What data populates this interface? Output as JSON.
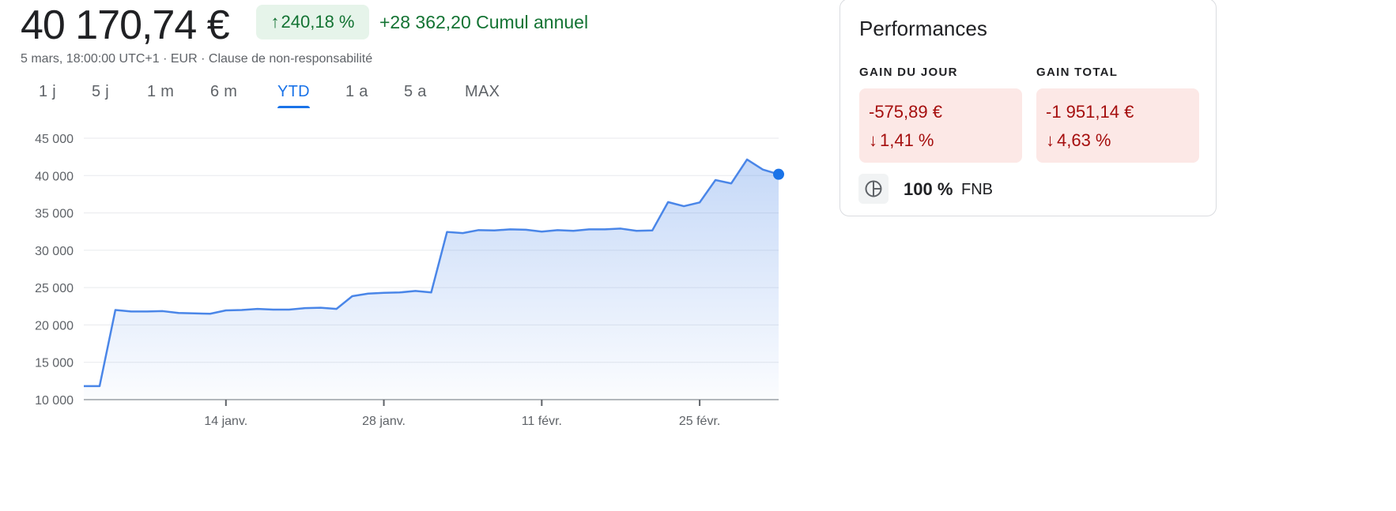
{
  "header": {
    "price": "40 170,74 €",
    "change_pct": "240,18 %",
    "change_abs": "+28 362,20",
    "change_period": "Cumul annuel",
    "timestamp": "5 mars, 18:00:00 UTC+1",
    "currency": "EUR",
    "disclaimer": "Clause de non-responsabilité",
    "separator": "·"
  },
  "ranges": [
    {
      "label": "1 j",
      "active": false
    },
    {
      "label": "5 j",
      "active": false
    },
    {
      "label": "1 m",
      "active": false
    },
    {
      "label": "6 m",
      "active": false
    },
    {
      "label": "YTD",
      "active": true
    },
    {
      "label": "1 a",
      "active": false
    },
    {
      "label": "5 a",
      "active": false
    },
    {
      "label": "MAX",
      "active": false
    }
  ],
  "performance": {
    "title": "Performances",
    "day_gain": {
      "label": "GAIN DU JOUR",
      "value": "-575,89 €",
      "pct": "1,41 %"
    },
    "total_gain": {
      "label": "GAIN TOTAL",
      "value": "-1 951,14 €",
      "pct": "4,63 %"
    },
    "fund": {
      "pct": "100 %",
      "name": "FNB",
      "icon": "pie-chart-icon"
    }
  },
  "colors": {
    "positive": "#137333",
    "positive_bg": "#e6f4ea",
    "negative": "#a50e0e",
    "negative_bg": "#fce8e6",
    "line": "#4a86e8",
    "accent": "#1a73e8"
  },
  "chart_data": {
    "type": "area",
    "x": [
      "2025-01-01",
      "2025-01-02",
      "2025-01-03",
      "2025-01-06",
      "2025-01-07",
      "2025-01-08",
      "2025-01-09",
      "2025-01-10",
      "2025-01-13",
      "2025-01-14",
      "2025-01-15",
      "2025-01-16",
      "2025-01-17",
      "2025-01-20",
      "2025-01-21",
      "2025-01-22",
      "2025-01-23",
      "2025-01-24",
      "2025-01-27",
      "2025-01-28",
      "2025-01-29",
      "2025-01-30",
      "2025-01-31",
      "2025-02-03",
      "2025-02-04",
      "2025-02-05",
      "2025-02-06",
      "2025-02-07",
      "2025-02-10",
      "2025-02-11",
      "2025-02-12",
      "2025-02-13",
      "2025-02-14",
      "2025-02-17",
      "2025-02-18",
      "2025-02-19",
      "2025-02-20",
      "2025-02-21",
      "2025-02-24",
      "2025-02-25",
      "2025-02-26",
      "2025-02-27",
      "2025-02-28",
      "2025-03-03",
      "2025-03-04",
      "2025-03-05"
    ],
    "values": [
      11808,
      11808,
      22000,
      21800,
      21800,
      21850,
      21600,
      21550,
      21500,
      21950,
      22000,
      22150,
      22050,
      22050,
      22250,
      22300,
      22150,
      23850,
      24200,
      24300,
      24350,
      24550,
      24350,
      32450,
      32300,
      32700,
      32650,
      32800,
      32750,
      32500,
      32700,
      32600,
      32800,
      32800,
      32900,
      32600,
      32650,
      36450,
      35900,
      36400,
      39400,
      38950,
      42150,
      40800,
      40170.74
    ],
    "xticks": [
      {
        "label": "14 janv.",
        "date": "2025-01-14"
      },
      {
        "label": "28 janv.",
        "date": "2025-01-28"
      },
      {
        "label": "11 févr.",
        "date": "2025-02-11"
      },
      {
        "label": "25 févr.",
        "date": "2025-02-25"
      }
    ],
    "yticks": [
      10000,
      15000,
      20000,
      25000,
      30000,
      35000,
      40000,
      45000
    ],
    "ytick_labels": [
      "10 000",
      "15 000",
      "20 000",
      "25 000",
      "30 000",
      "35 000",
      "40 000",
      "45 000"
    ],
    "ylim": [
      10000,
      45000
    ],
    "grid": true,
    "last_point_marker": true
  }
}
